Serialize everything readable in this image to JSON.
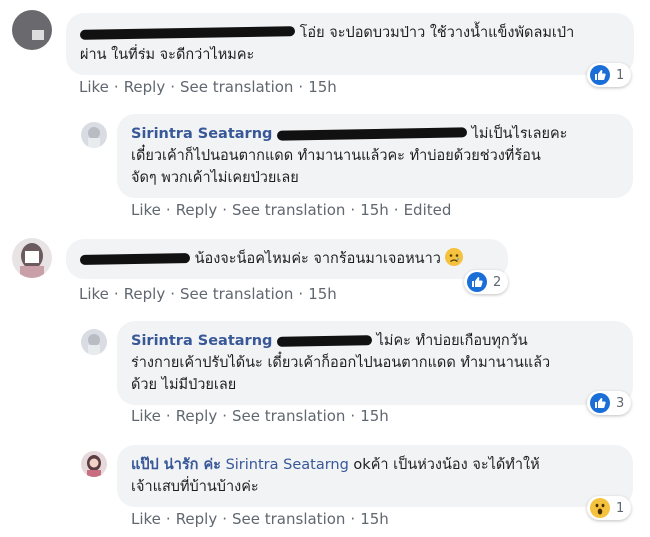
{
  "actions": {
    "like": "Like",
    "reply": "Reply",
    "see_translation": "See translation",
    "sep": "·"
  },
  "comments": [
    {
      "author": "",
      "text_line1": " โอ่ย จะปอดบวมป่าว ใช้วางน้ำแข็งพัดลมเป่า",
      "text_line2": "ผ่าน ในที่ร่ม จะดีกว่าไหมคะ",
      "time": "15h",
      "edited": "",
      "reaction_count": "1"
    },
    {
      "author": "Sirintra Seatarng",
      "text_line1": " ไม่เป็นไรเลยคะ",
      "text_line2": "เดี๋ยวเค้าก็ไปนอนตากแดด ทำมานานแล้วคะ ทำบ่อยด้วยช่วงที่ร้อน",
      "text_line3": "จัดๆ พวกเค้าไม่เคยป่วยเลย",
      "time": "15h",
      "edited": "Edited"
    },
    {
      "text_line1": " น้องจะน็อคไหมค่ะ จากร้อนมาเจอหนาว",
      "time": "15h",
      "reaction_count": "2"
    },
    {
      "author": "Sirintra Seatarng",
      "text_line1": " ไม่คะ ทำบ่อยเกือบทุกวัน",
      "text_line2": "ร่างกายเค้าปรับได้นะ เดี๋ยวเค้าก็ออกไปนอนตากแดด ทำมานานแล้ว",
      "text_line3": "ด้วย ไม่มีป่วยเลย",
      "time": "15h",
      "reaction_count": "3"
    },
    {
      "author": "แป๊ป น่ารัก ค่ะ",
      "mention": "Sirintra Seatarng",
      "text_line1": " okค้า เป็นห่วงน้อง จะได้ทำให้",
      "text_line2": "เจ้าแสบที่บ้านบ้างค่ะ",
      "time": "15h",
      "reaction_count": "1"
    }
  ],
  "colors": {
    "link": "#385898",
    "bubble": "#f2f3f5",
    "like_blue": "#1a6ed8"
  }
}
